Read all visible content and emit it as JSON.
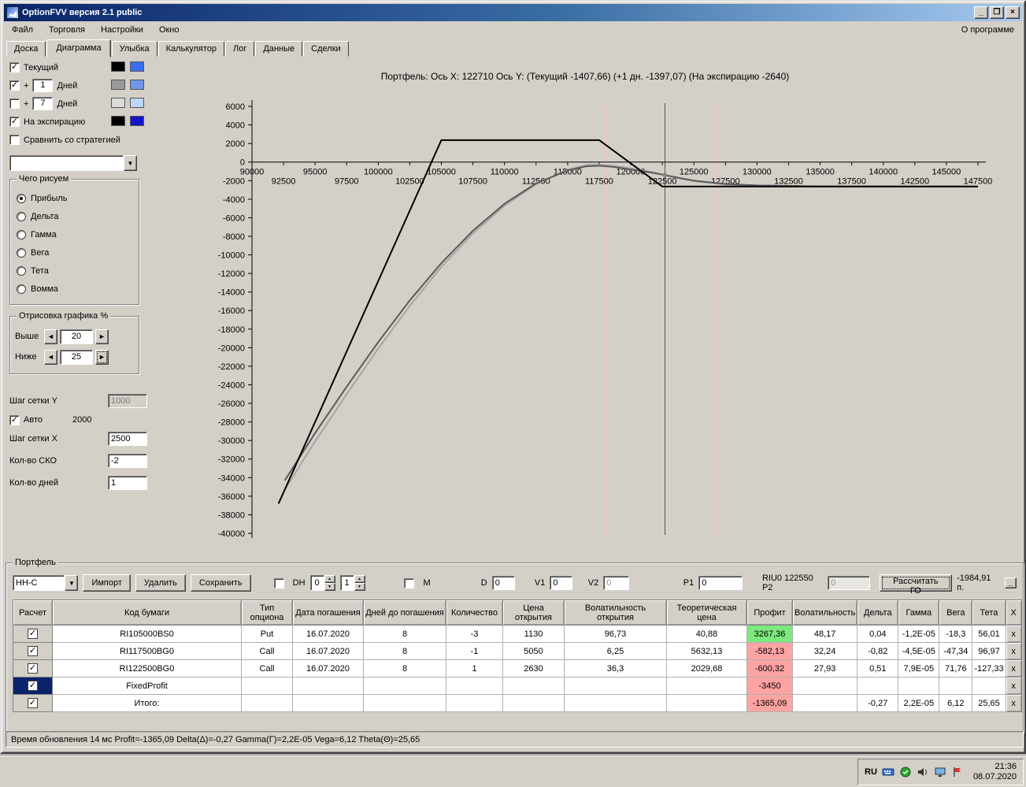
{
  "window": {
    "title": "OptionFVV версия 2.1 public",
    "menu_items": [
      "Файл",
      "Торговля",
      "Настройки",
      "Окно"
    ],
    "about_label": "О программе",
    "minimize": "_",
    "maximize": "❐",
    "close": "×"
  },
  "tabs": {
    "items": [
      "Доска",
      "Диаграмма",
      "Улыбка",
      "Калькулятор",
      "Лог",
      "Данные",
      "Сделки"
    ],
    "active": "Диаграмма"
  },
  "left_panel": {
    "series_toggles": [
      {
        "label": "Текущий",
        "checked": true,
        "colors": [
          "#000000",
          "#3a6ff2"
        ]
      },
      {
        "label": "+",
        "days": "1",
        "days_label": "Дней",
        "checked": true,
        "colors": [
          "#9a9a9a",
          "#6f96e8"
        ]
      },
      {
        "label": "+",
        "days": "7",
        "days_label": "Дней",
        "checked": false,
        "colors": [
          "#dcdcdc",
          "#bcd7f7"
        ]
      },
      {
        "label": "На экспирацию",
        "checked": true,
        "colors": [
          "#000000",
          "#1414c8"
        ]
      }
    ],
    "compare_label": "Сравнить со стратегией",
    "compare_checked": false,
    "strategy_select_value": "",
    "draw_group": {
      "title": "Чего рисуем",
      "options": [
        "Прибыль",
        "Дельта",
        "Гамма",
        "Вега",
        "Тета",
        "Вомма"
      ],
      "selected": "Прибыль"
    },
    "render_group": {
      "title": "Отрисовка графика %",
      "rows": [
        {
          "label": "Выше",
          "value": "20"
        },
        {
          "label": "Ниже",
          "value": "25"
        }
      ]
    },
    "grid_y": {
      "label": "Шаг сетки Y",
      "value": "1000",
      "auto_label": "Авто",
      "auto_checked": true,
      "auto_value": "2000"
    },
    "grid_x": {
      "label": "Шаг сетки X",
      "value": "2500"
    },
    "sko": {
      "label": "Кол-во СКО",
      "value": "-2"
    },
    "days": {
      "label": "Кол-во дней",
      "value": "1"
    }
  },
  "chart_data": {
    "type": "line",
    "title": "Портфель:  Ось X:  122710  Ось Y:   (Текущий -1407,66)  (+1 дн. -1397,07)  (На экспирацию -2640)",
    "xlim": [
      90000,
      147500
    ],
    "ylim": [
      -40000,
      6000
    ],
    "x_major_ticks": [
      90000,
      95000,
      100000,
      105000,
      110000,
      115000,
      120000,
      125000,
      130000,
      135000,
      140000,
      145000
    ],
    "x_minor_ticks": [
      92500,
      97500,
      102500,
      107500,
      112500,
      117500,
      122500,
      127500,
      132500,
      137500,
      142500,
      147500
    ],
    "y_tick_step": 2000,
    "cursor_x": 122710,
    "cursor_y": -1408,
    "sko_lines": [
      118100,
      126800
    ],
    "series": [
      {
        "name": "На экспирацию",
        "color": "#000000",
        "width": 2,
        "points": [
          [
            92100,
            -36800
          ],
          [
            105000,
            2360
          ],
          [
            117500,
            2360
          ],
          [
            122500,
            -2640
          ],
          [
            147500,
            -2640
          ]
        ]
      },
      {
        "name": "Текущий",
        "color": "#5a5a5a",
        "width": 2,
        "points": [
          [
            92600,
            -34300
          ],
          [
            95000,
            -29200
          ],
          [
            97500,
            -24200
          ],
          [
            100000,
            -19400
          ],
          [
            102500,
            -14900
          ],
          [
            105000,
            -10900
          ],
          [
            107500,
            -7400
          ],
          [
            110000,
            -4500
          ],
          [
            112500,
            -2300
          ],
          [
            115000,
            -900
          ],
          [
            116500,
            -450
          ],
          [
            117500,
            -400
          ],
          [
            118500,
            -500
          ],
          [
            120000,
            -800
          ],
          [
            121500,
            -1100
          ],
          [
            122710,
            -1408
          ],
          [
            124000,
            -1760
          ],
          [
            125000,
            -2000
          ],
          [
            127500,
            -2360
          ],
          [
            130000,
            -2520
          ],
          [
            135000,
            -2620
          ],
          [
            140000,
            -2640
          ],
          [
            147500,
            -2640
          ]
        ]
      },
      {
        "name": "+1 день",
        "color": "#a6a6a6",
        "width": 2,
        "points": [
          [
            92600,
            -35300
          ],
          [
            95000,
            -30100
          ],
          [
            97500,
            -25000
          ],
          [
            100000,
            -20100
          ],
          [
            102500,
            -15500
          ],
          [
            105000,
            -11300
          ],
          [
            107500,
            -7700
          ],
          [
            110000,
            -4700
          ],
          [
            112500,
            -2400
          ],
          [
            115000,
            -800
          ],
          [
            116500,
            -330
          ],
          [
            117500,
            -280
          ],
          [
            118500,
            -380
          ],
          [
            120000,
            -680
          ],
          [
            121500,
            -1040
          ],
          [
            122710,
            -1397
          ],
          [
            124000,
            -1780
          ],
          [
            125000,
            -2060
          ],
          [
            127500,
            -2430
          ],
          [
            130000,
            -2570
          ],
          [
            135000,
            -2640
          ],
          [
            140000,
            -2640
          ],
          [
            147500,
            -2640
          ]
        ]
      }
    ]
  },
  "portfolio": {
    "group_title": "Портфель",
    "portfolio_select": "НН-С",
    "buttons": {
      "import": "Импорт",
      "delete": "Удалить",
      "save": "Сохранить"
    },
    "dh_label": "DH",
    "dh_spin1": "0",
    "dh_spin2": "1",
    "m_label": "М",
    "d_label": "D",
    "d_value": "0",
    "v1_label": "V1",
    "v1_value": "0",
    "v2_label": "V2",
    "v2_value": "0",
    "p1_label": "P1",
    "p1_value": "0",
    "instrument_label": "RIU0 122550  P2",
    "p2_value": "0",
    "calc_button": "Рассчитать ГО",
    "go_value": "-1984,91 п.",
    "collapse_label": "_",
    "table": {
      "headers": [
        "Расчет",
        "Код бумаги",
        "Тип опциона",
        "Дата погашения",
        "Дней до погашения",
        "Количество",
        "Цена открытия",
        "Волатильность открытия",
        "Теоретическая цена",
        "Профит",
        "Волатильность",
        "Дельта",
        "Гамма",
        "Вега",
        "Тета",
        "X"
      ],
      "delete_glyph": "x",
      "rows": [
        {
          "checked": true,
          "selected": false,
          "profit_color": "green",
          "cells": [
            "RI105000BS0",
            "Put",
            "16.07.2020",
            "8",
            "-3",
            "1130",
            "96,73",
            "40,88",
            "3267,36",
            "48,17",
            "0,04",
            "-1,2E-05",
            "-18,3",
            "56,01"
          ]
        },
        {
          "checked": true,
          "selected": false,
          "profit_color": "red",
          "cells": [
            "RI117500BG0",
            "Call",
            "16.07.2020",
            "8",
            "-1",
            "5050",
            "6,25",
            "5632,13",
            "-582,13",
            "32,24",
            "-0,82",
            "-4,5E-05",
            "-47,34",
            "96,97"
          ]
        },
        {
          "checked": true,
          "selected": false,
          "profit_color": "red",
          "cells": [
            "RI122500BG0",
            "Call",
            "16.07.2020",
            "8",
            "1",
            "2630",
            "36,3",
            "2029,68",
            "-600,32",
            "27,93",
            "0,51",
            "7,9E-05",
            "71,76",
            "-127,33"
          ]
        },
        {
          "checked": true,
          "selected": true,
          "profit_color": "red",
          "cells": [
            "FixedProfit",
            "",
            "",
            "",
            "",
            "",
            "",
            "",
            "-3450",
            "",
            "",
            "",
            "",
            ""
          ]
        },
        {
          "checked": true,
          "selected": false,
          "profit_color": "red",
          "cells": [
            "Итого:",
            "",
            "",
            "",
            "",
            "",
            "",
            "",
            "-1365,09",
            "",
            "-0,27",
            "2,2E-05",
            "6,12",
            "25,65"
          ]
        }
      ]
    }
  },
  "status_bar": "Время обновления 14 мс    Profit=-1365,09 Delta(Δ)=-0,27 Gamma(Γ)=2,2E-05 Vega=6,12 Theta(Θ)=25,65",
  "taskbar": {
    "lang": "RU",
    "time": "21:36",
    "date": "08.07.2020"
  }
}
